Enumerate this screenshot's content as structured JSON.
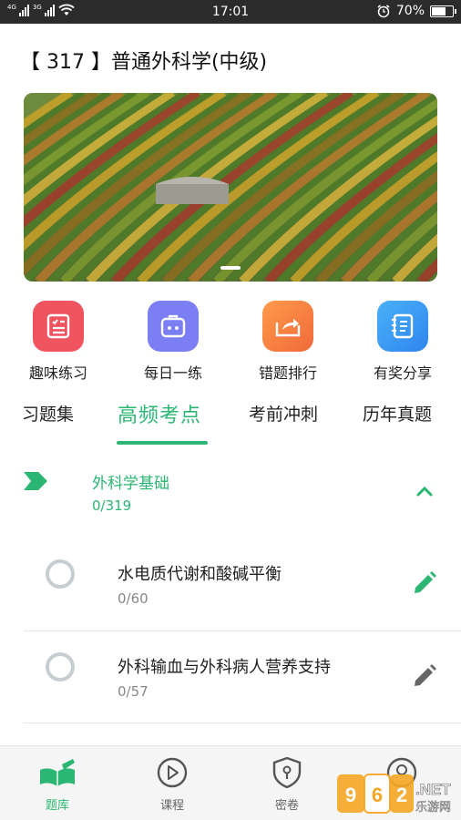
{
  "status_bar": {
    "network_1": "4G",
    "network_2": "3G",
    "time": "17:01",
    "battery_percent": "70%",
    "battery_level": 0.7
  },
  "page": {
    "title": "【 317 】普通外科学(中级)"
  },
  "banner": {
    "slide_count_indicator": "1"
  },
  "features": [
    {
      "label": "趣味练习",
      "icon": "checklist-icon",
      "color": "#f0555f"
    },
    {
      "label": "每日一练",
      "icon": "briefcase-icon",
      "color": "#7b7ff3"
    },
    {
      "label": "错题排行",
      "icon": "share-folder-icon",
      "color": "#f78a4a"
    },
    {
      "label": "有奖分享",
      "icon": "notebook-icon",
      "color": "#3a9df2"
    }
  ],
  "tabs": [
    {
      "label": "习题集",
      "active": false
    },
    {
      "label": "高频考点",
      "active": true
    },
    {
      "label": "考前冲刺",
      "active": false
    },
    {
      "label": "历年真题",
      "active": false
    }
  ],
  "chapter": {
    "title": "外科学基础",
    "progress": "0/319",
    "expanded": true
  },
  "sections": [
    {
      "title": "水电质代谢和酸碱平衡",
      "progress": "0/60",
      "pencil_color": "#2bb673"
    },
    {
      "title": "外科输血与外科病人营养支持",
      "progress": "0/57",
      "pencil_color": "#666666"
    }
  ],
  "bottom_nav": [
    {
      "label": "题库",
      "icon": "book-icon",
      "active": true
    },
    {
      "label": "课程",
      "icon": "play-circle-icon",
      "active": false
    },
    {
      "label": "密卷",
      "icon": "shield-lock-icon",
      "active": false
    },
    {
      "label": "",
      "icon": "user-icon",
      "active": false
    }
  ],
  "watermark": {
    "brand": "962",
    "domain": ".NET",
    "site": "乐游网"
  },
  "colors": {
    "accent": "#2bb673",
    "status_bar": "#2b2b2b"
  }
}
